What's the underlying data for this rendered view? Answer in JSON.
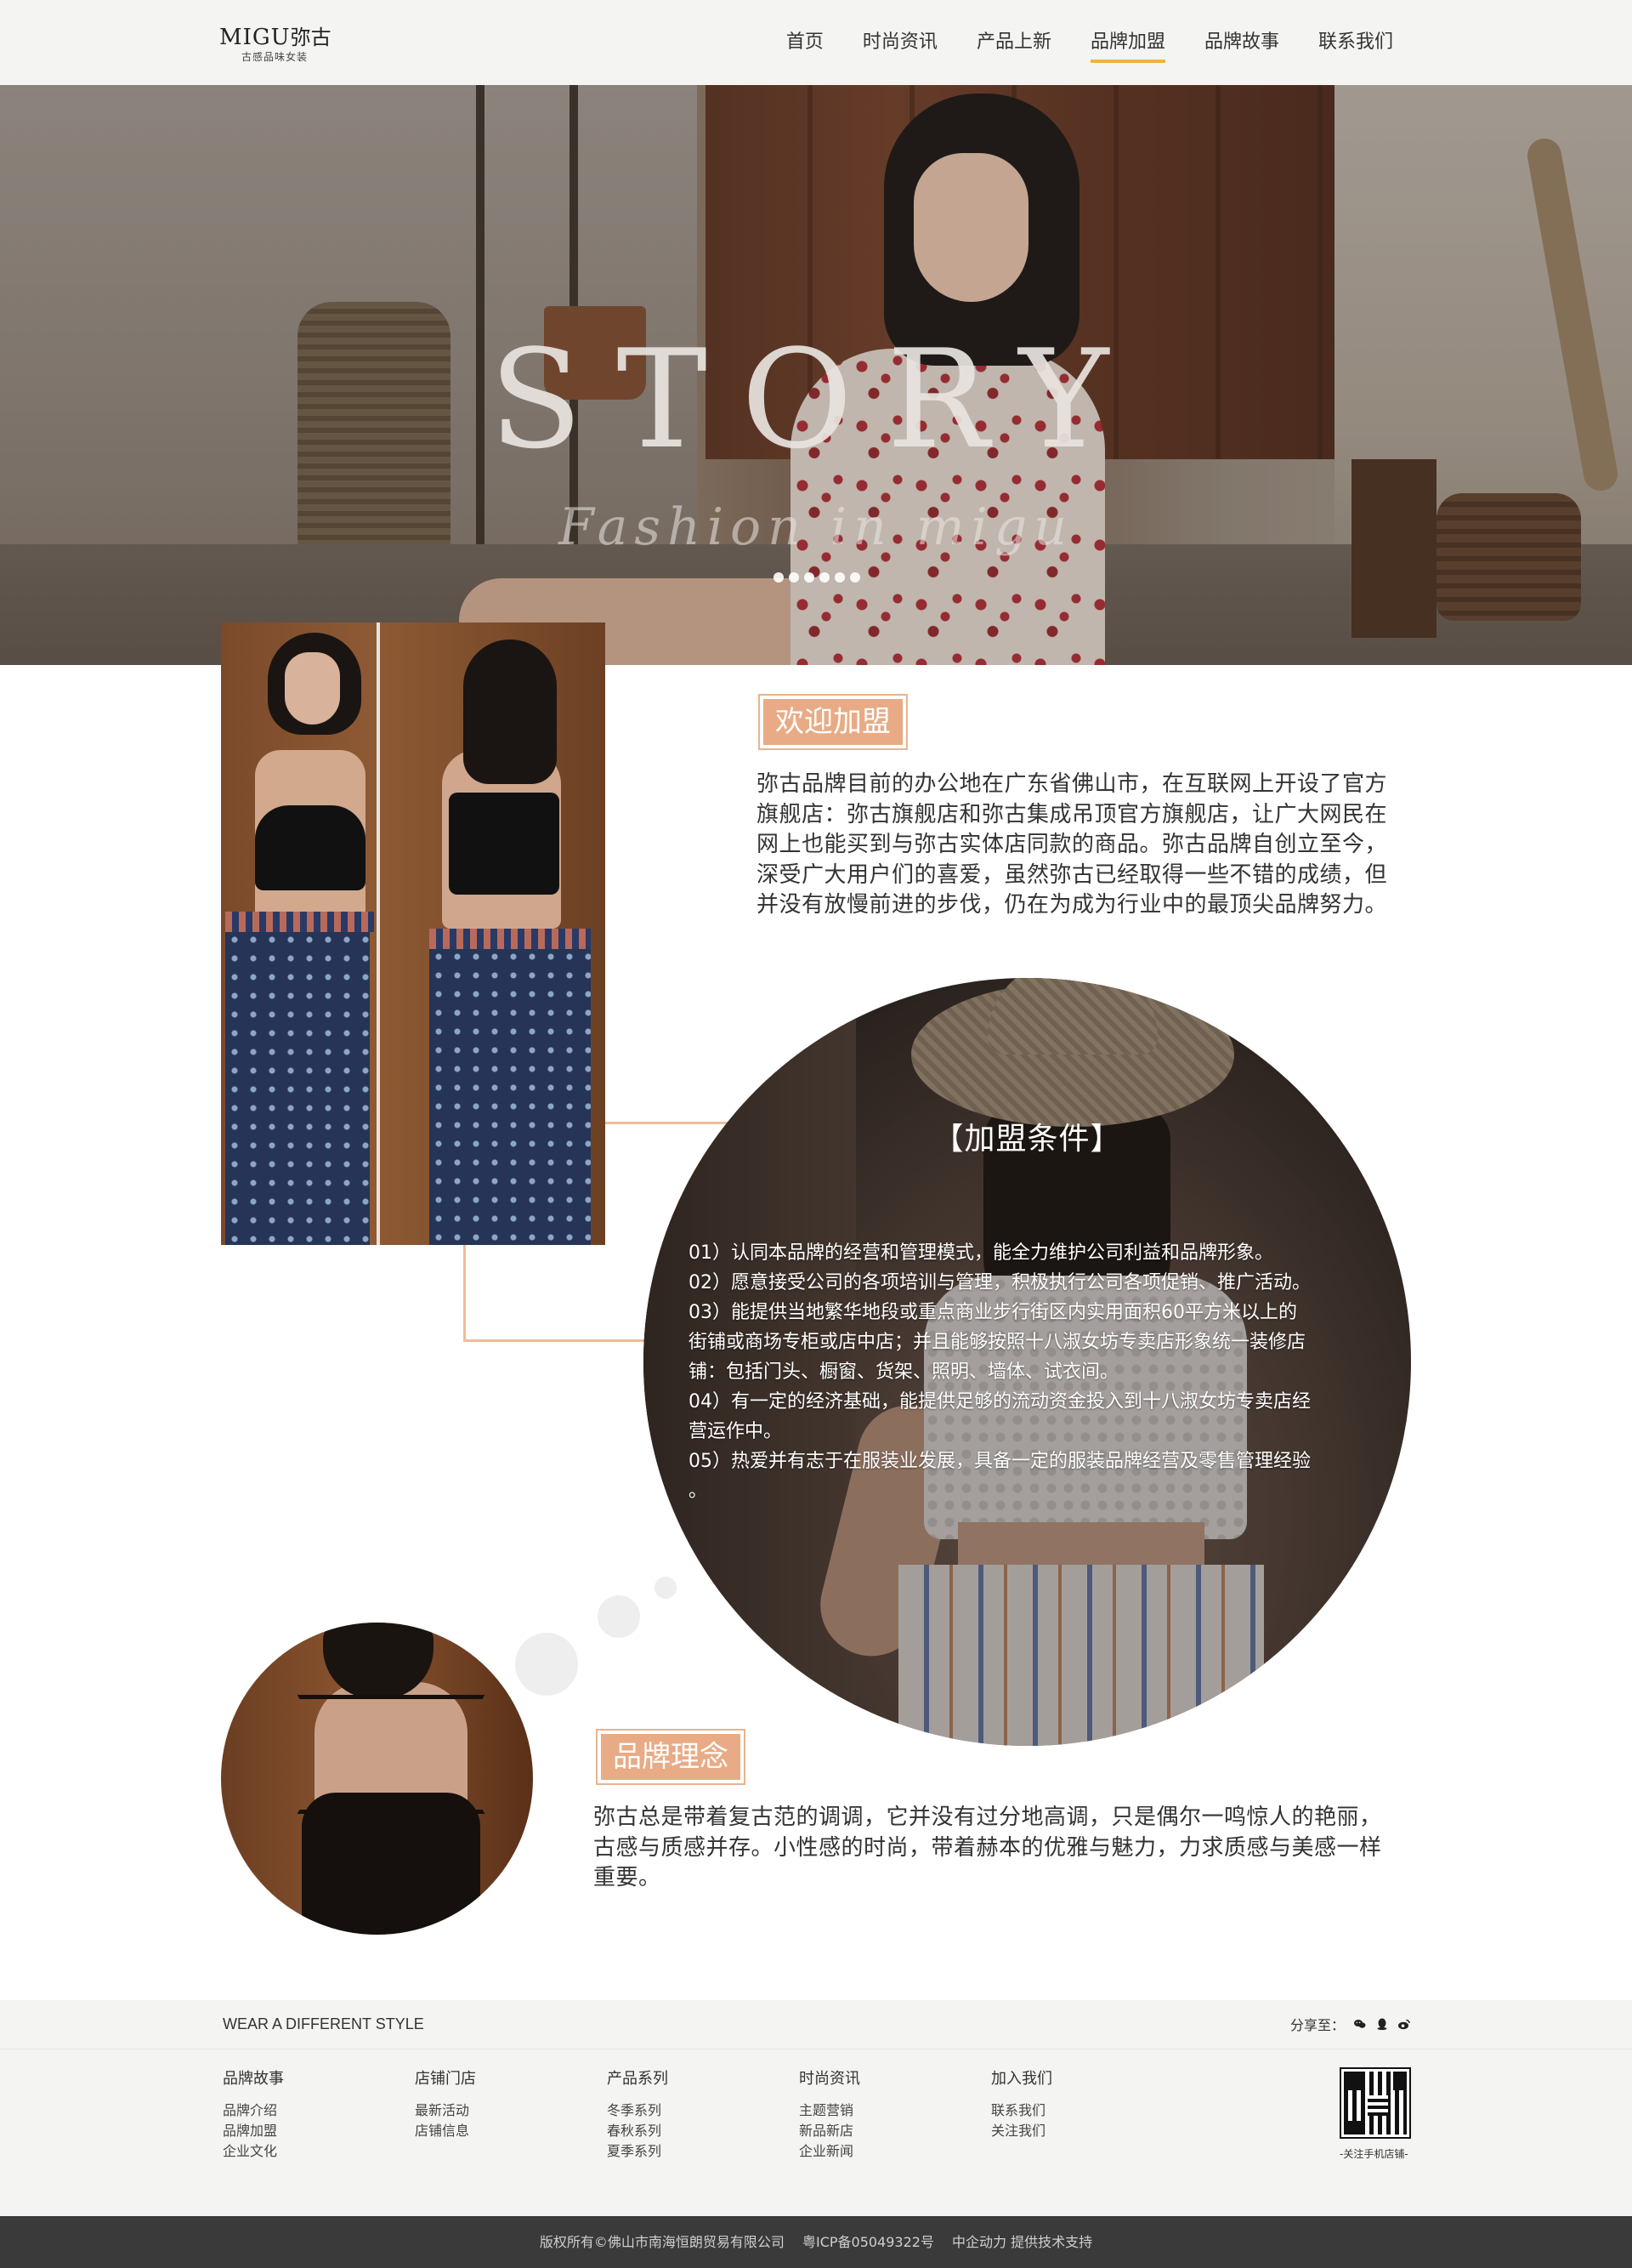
{
  "header": {
    "logo_main": "MIGU",
    "logo_cn": "弥古",
    "logo_sub": "古感品味女装",
    "nav": [
      {
        "label": "首页"
      },
      {
        "label": "时尚资讯"
      },
      {
        "label": "产品上新"
      },
      {
        "label": "品牌加盟"
      },
      {
        "label": "品牌故事"
      },
      {
        "label": "联系我们"
      }
    ],
    "active_nav": "品牌加盟"
  },
  "hero": {
    "title": "STORY",
    "subtitle": "Fashion in migu",
    "slides": 6
  },
  "welcome": {
    "heading": "欢迎加盟",
    "text": "弥古品牌目前的办公地在广东省佛山市，在互联网上开设了官方旗舰店：弥古旗舰店和弥古集成吊顶官方旗舰店，让广大网民在网上也能买到与弥古实体店同款的商品。弥古品牌自创立至今，深受广大用户们的喜爱，虽然弥古已经取得一些不错的成绩，但并没有放慢前进的步伐，仍在为成为行业中的最顶尖品牌努力。"
  },
  "conditions": {
    "title": "【加盟条件】",
    "items": [
      "01）认同本品牌的经营和管理模式，能全力维护公司利益和品牌形象。",
      "02）愿意接受公司的各项培训与管理，积极执行公司各项促销、推广活动。",
      "03）能提供当地繁华地段或重点商业步行街区内实用面积60平方米以上的",
      "街铺或商场专柜或店中店；并且能够按照十八淑女坊专卖店形象统一装修店",
      "铺：包括门头、橱窗、货架、照明、墙体、试衣间。",
      "04）有一定的经济基础，能提供足够的流动资金投入到十八淑女坊专卖店经",
      "营运作中。",
      "05）热爱并有志于在服装业发展，具备一定的服装品牌经营及零售管理经验",
      "。"
    ]
  },
  "brand": {
    "heading": "品牌理念",
    "text": "弥古总是带着复古范的调调，它并没有过分地高调，只是偶尔一鸣惊人的艳丽，古感与质感并存。小性感的时尚，带着赫本的优雅与魅力，力求质感与美感一样重要。"
  },
  "footer": {
    "slogan": "WEAR A DIFFERENT STYLE",
    "share_label": "分享至：",
    "share_icons": [
      "wechat-icon",
      "qq-icon",
      "weibo-icon"
    ],
    "columns": [
      {
        "title": "品牌故事",
        "links": [
          "品牌介绍",
          "品牌加盟",
          "企业文化"
        ]
      },
      {
        "title": "店铺门店",
        "links": [
          "最新活动",
          "店铺信息"
        ]
      },
      {
        "title": "产品系列",
        "links": [
          "冬季系列",
          "春秋系列",
          "夏季系列"
        ]
      },
      {
        "title": "时尚资讯",
        "links": [
          "主题营销",
          "新品新店",
          "企业新闻"
        ]
      },
      {
        "title": "加入我们",
        "links": [
          "联系我们",
          "关注我们"
        ]
      }
    ],
    "qr_label": "-关注手机店铺-",
    "copyright": "版权所有©佛山市南海恒朗贸易有限公司",
    "icp": "粤ICP备05049322号",
    "support": "中企动力 提供技术支持"
  },
  "colors": {
    "accent": "#e8ab85",
    "nav_underline": "#f0b43c",
    "footer_bg": "#f4f4f2",
    "copyright_bg": "#3a3a3a"
  }
}
